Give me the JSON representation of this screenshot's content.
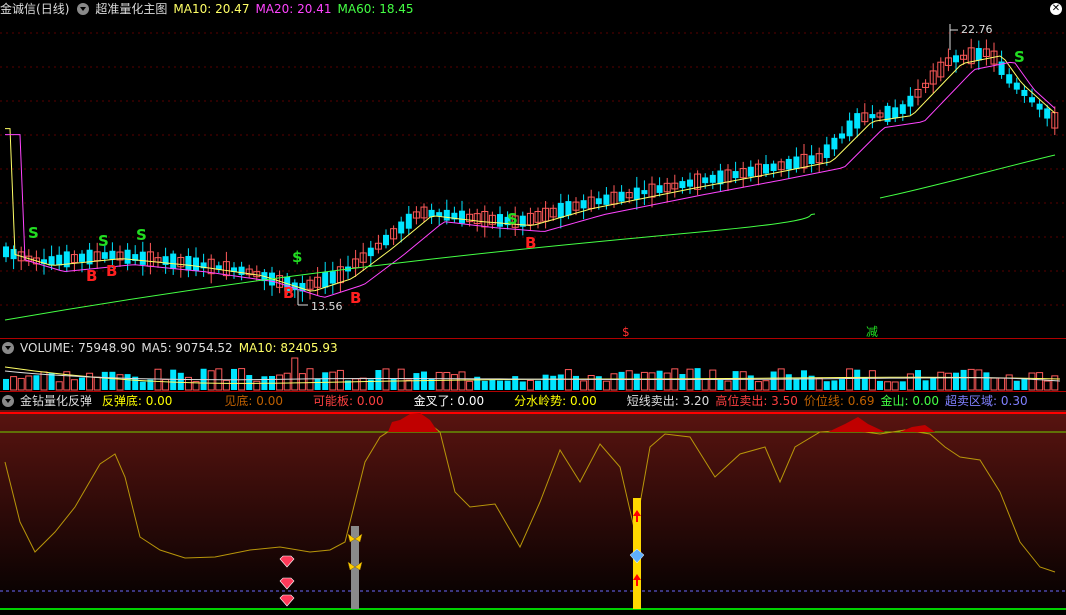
{
  "main": {
    "stock_name": "金诚信",
    "period": "(日线)",
    "indicator_name": "超准量化主图",
    "ma10_label": "MA10: 20.47",
    "ma20_label": "MA20: 20.41",
    "ma60_label": "MA60: 18.45",
    "high_label": "22.76",
    "low_label": "13.56",
    "signal_bottom_1": "$",
    "signal_bottom_2": "减",
    "colors": {
      "up": "#ff5a5a",
      "down": "#00e5ff",
      "ma10": "#ffff66",
      "ma20": "#ff44ff",
      "ma60": "#44ff44"
    }
  },
  "volume": {
    "title": "VOLUME: 75948.90",
    "ma5": "MA5: 90754.52",
    "ma10": "MA10: 82405.93"
  },
  "indicator": {
    "name": "金钻量化反弹",
    "items": [
      {
        "label": "反弹底: 0.00",
        "color": "#ffff00"
      },
      {
        "label": "见底: 0.00",
        "color": "#c06000"
      },
      {
        "label": "可能板: 0.00",
        "color": "#ff4040"
      },
      {
        "label": "金叉了: 0.00",
        "color": "#ffffff"
      },
      {
        "label": "分水岭势: 0.00",
        "color": "#ffff00"
      },
      {
        "label": "短线卖出: 3.20",
        "color": "#dddddd"
      },
      {
        "label": "高位卖出: 3.50",
        "color": "#ff4040"
      },
      {
        "label": "价位线: 0.69",
        "color": "#c06000"
      },
      {
        "label": "金山: 0.00",
        "color": "#44ff44"
      },
      {
        "label": "超卖区域: 0.30",
        "color": "#8080ff"
      }
    ]
  },
  "chart_data": {
    "type": "candlestick",
    "overlays": [
      "MA10",
      "MA20",
      "MA60"
    ],
    "markers": [
      {
        "text": "S",
        "color": "#22dd22"
      },
      {
        "text": "S",
        "color": "#22dd22"
      },
      {
        "text": "S",
        "color": "#22dd22"
      },
      {
        "text": "$",
        "color": "#22dd22"
      },
      {
        "text": "S",
        "color": "#22dd22"
      },
      {
        "text": "S",
        "color": "#22dd22"
      },
      {
        "text": "B",
        "color": "#ff2020"
      },
      {
        "text": "B",
        "color": "#ff2020"
      },
      {
        "text": "B",
        "color": "#ff2020"
      },
      {
        "text": "B",
        "color": "#ff2020"
      },
      {
        "text": "B",
        "color": "#ff2020"
      }
    ]
  }
}
